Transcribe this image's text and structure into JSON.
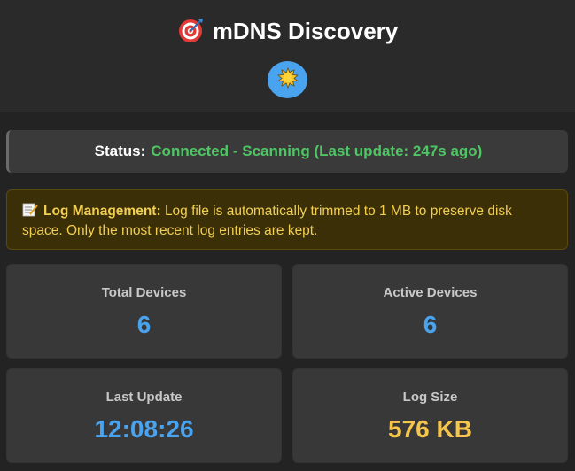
{
  "header": {
    "title": "mDNS Discovery",
    "title_icon": "target-icon",
    "theme_toggle_icon": "sun-icon"
  },
  "status": {
    "label": "Status:",
    "value": "Connected - Scanning (Last update: 247s ago)",
    "color": "#4fc664"
  },
  "notice": {
    "icon": "memo-icon",
    "label": "Log Management:",
    "text": "Log file is automatically trimmed to 1 MB to preserve disk space. Only the most recent log entries are kept."
  },
  "stats": {
    "total_devices": {
      "label": "Total Devices",
      "value": "6"
    },
    "active_devices": {
      "label": "Active Devices",
      "value": "6"
    },
    "last_update": {
      "label": "Last Update",
      "value": "12:08:26"
    },
    "log_size": {
      "label": "Log Size",
      "value": "576 KB"
    }
  },
  "colors": {
    "accent_blue": "#4aa3ee",
    "accent_yellow": "#f5c64a",
    "status_green": "#4fc664"
  }
}
